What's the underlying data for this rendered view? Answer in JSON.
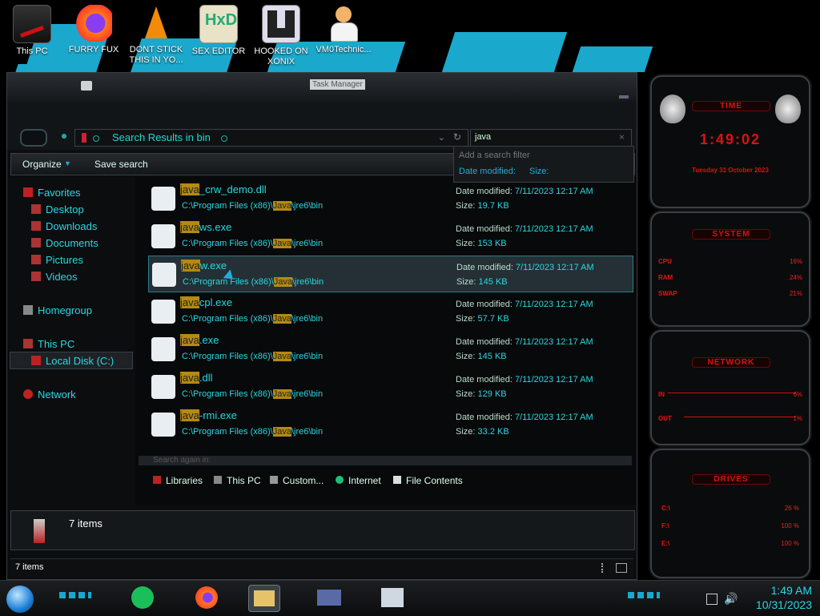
{
  "desktop": {
    "icons": [
      {
        "label": "This PC"
      },
      {
        "label": "FURRY FUX"
      },
      {
        "label": "DONT STICK THIS IN YO..."
      },
      {
        "label": "SEX EDITOR"
      },
      {
        "label": "HOOKED ON XONIX"
      },
      {
        "label": "VM0Technic..."
      }
    ]
  },
  "explorer": {
    "title": "Task Manager",
    "address": "Search Results in bin",
    "search_value": "java",
    "toolbar": {
      "organize": "Organize",
      "save_search": "Save search"
    },
    "search_filter": {
      "header": "Add a search filter",
      "date_modified": "Date modified:",
      "size": "Size:"
    },
    "nav": {
      "favorites": "Favorites",
      "desktop": "Desktop",
      "downloads": "Downloads",
      "documents": "Documents",
      "pictures": "Pictures",
      "videos": "Videos",
      "homegroup": "Homegroup",
      "this_pc": "This PC",
      "local_disk": "Local Disk (C:)",
      "network": "Network"
    },
    "files": [
      {
        "prefix": "java",
        "suffix": "_crw_demo.dll",
        "path_a": "C:\\Program Files (x86)\\",
        "path_hl": "Java",
        "path_b": "\\jre6\\bin",
        "date_label": "Date modified:",
        "date": "7/11/2023 12:17 AM",
        "size_label": "Size:",
        "size": "19.7 KB"
      },
      {
        "prefix": "java",
        "suffix": "ws.exe",
        "path_a": "C:\\Program Files (x86)\\",
        "path_hl": "Java",
        "path_b": "\\jre6\\bin",
        "date_label": "Date modified:",
        "date": "7/11/2023 12:17 AM",
        "size_label": "Size:",
        "size": "153 KB"
      },
      {
        "prefix": "java",
        "suffix": "w.exe",
        "path_a": "C:\\Program Files (x86)\\",
        "path_hl": "Java",
        "path_b": "\\jre6\\bin",
        "date_label": "Date modified:",
        "date": "7/11/2023 12:17 AM",
        "size_label": "Size:",
        "size": "145 KB"
      },
      {
        "prefix": "java",
        "suffix": "cpl.exe",
        "path_a": "C:\\Program Files (x86)\\",
        "path_hl": "Java",
        "path_b": "\\jre6\\bin",
        "date_label": "Date modified:",
        "date": "7/11/2023 12:17 AM",
        "size_label": "Size:",
        "size": "57.7 KB"
      },
      {
        "prefix": "java",
        "suffix": ".exe",
        "path_a": "C:\\Program Files (x86)\\",
        "path_hl": "Java",
        "path_b": "\\jre6\\bin",
        "date_label": "Date modified:",
        "date": "7/11/2023 12:17 AM",
        "size_label": "Size:",
        "size": "145 KB"
      },
      {
        "prefix": "java",
        "suffix": ".dll",
        "path_a": "C:\\Program Files (x86)\\",
        "path_hl": "Java",
        "path_b": "\\jre6\\bin",
        "date_label": "Date modified:",
        "date": "7/11/2023 12:17 AM",
        "size_label": "Size:",
        "size": "129 KB"
      },
      {
        "prefix": "java",
        "suffix": "-rmi.exe",
        "path_a": "C:\\Program Files (x86)\\",
        "path_hl": "Java",
        "path_b": "\\jre6\\bin",
        "date_label": "Date modified:",
        "date": "7/11/2023 12:17 AM",
        "size_label": "Size:",
        "size": "33.2 KB"
      }
    ],
    "search_again": {
      "label": "Search again in:",
      "items": [
        "Libraries",
        "This PC",
        "Custom...",
        "Internet",
        "File Contents"
      ]
    },
    "details_count": "7 items",
    "status_count": "7 items"
  },
  "gadgets": {
    "time": {
      "title": "TIME",
      "clock": "1:49:02",
      "date": "Tuesday 31 October 2023"
    },
    "system": {
      "title": "SYSTEM",
      "rows": [
        {
          "label": "CPU",
          "value": "16%"
        },
        {
          "label": "RAM",
          "value": "24%"
        },
        {
          "label": "SWAP",
          "value": "21%"
        }
      ]
    },
    "network": {
      "title": "NETWORK",
      "rows": [
        {
          "label": "IN",
          "value": "6%"
        },
        {
          "label": "OUT",
          "value": "1%"
        }
      ]
    },
    "drives": {
      "title": "DRIVES",
      "rows": [
        {
          "label": "C:\\",
          "value": "26 %"
        },
        {
          "label": "F:\\",
          "value": "100 %"
        },
        {
          "label": "E:\\",
          "value": "100 %"
        }
      ]
    }
  },
  "taskbar": {
    "time": "1:49 AM",
    "date": "10/31/2023"
  },
  "colors": {
    "accent": "#28d8e0",
    "highlight": "#b58a12",
    "gadget_red": "#e01010"
  }
}
